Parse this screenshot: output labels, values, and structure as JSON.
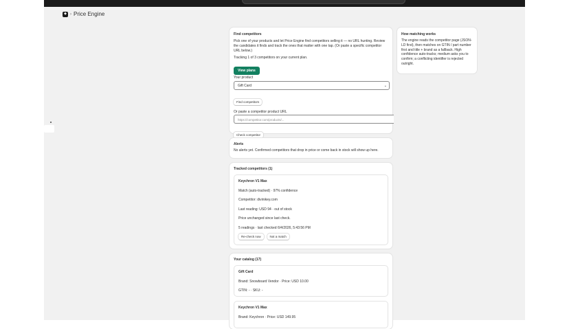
{
  "topbar": {
    "search_text": ""
  },
  "app": {
    "title": "Price Engine"
  },
  "find": {
    "heading": "Find competitors",
    "description": "Pick one of your products and let Price Engine find competitors selling it — no URL hunting. Review the candidates it finds and track the ones that matter with one tap. (Or paste a specific competitor URL below.)",
    "tracking": "Tracking 1 of 3 competitors on your current plan.",
    "view_plans": "View plans",
    "your_product_label": "Your product",
    "product_selected": "Gift Card",
    "find_button": "Find competitors",
    "or_paste_label": "Or paste a competitor product URL",
    "url_placeholder": "https://competitor.com/products/...",
    "check_button": "Check competitor"
  },
  "matching": {
    "heading": "How matching works",
    "text": "The engine reads the competitor page (JSON-LD first), then matches on GTIN / part number first and title + brand as a fallback. High confidence auto-tracks; medium asks you to confirm; a conflicting identifier is rejected outright."
  },
  "alerts": {
    "heading": "Alerts",
    "text": "No alerts yet. Confirmed competitors that drop in price or come back in stock will show up here."
  },
  "tracked": {
    "heading": "Tracked competitors (1)",
    "items": [
      {
        "title": "Keychron V1 Max",
        "match": "Match (auto-tracked) · 97% confidence",
        "competitor": "Competitor: divinikey.com",
        "last_reading": "Last reading: USD 94 · out of stock",
        "price_status": "Price unchanged since last check.",
        "readings": "5 readings · last checked 6/4/2026, 5:43:56 PM",
        "recheck_label": "Re-check now",
        "not_match_label": "Not a match"
      }
    ]
  },
  "catalog": {
    "heading": "Your catalog (17)",
    "items": [
      {
        "title": "Gift Card",
        "brand_price": "Brand: Snowboard Vendor · Price: USD 10.00",
        "ids": "GTIN: - · SKU: -"
      },
      {
        "title": "Keychron V1 Max",
        "brand_price": "Brand: Keychron · Price: USD 149.95"
      }
    ]
  },
  "colors": {
    "primary": "#138060",
    "background": "#f1f1f1",
    "topbar": "#1a1a1a"
  }
}
